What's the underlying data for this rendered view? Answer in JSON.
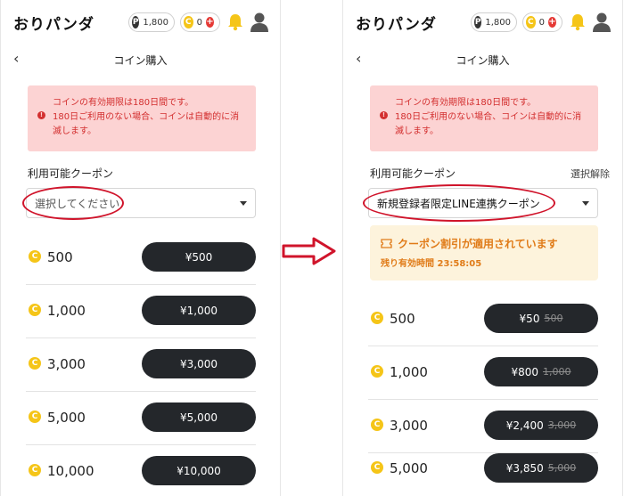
{
  "left": {
    "header": {
      "logo": "おりパンダ",
      "points": "1,800",
      "coins": "0"
    },
    "title": "コイン購入",
    "back": "‹",
    "alert": {
      "line1": "コインの有効期限は180日間です。",
      "line2": "180日ご利用のない場合、コインは自動的に消",
      "line3": "滅します。"
    },
    "coupon_label": "利用可能クーポン",
    "select_placeholder": "選択してください",
    "rows": [
      {
        "coins": "500",
        "price": "¥500"
      },
      {
        "coins": "1,000",
        "price": "¥1,000"
      },
      {
        "coins": "3,000",
        "price": "¥3,000"
      },
      {
        "coins": "5,000",
        "price": "¥5,000"
      },
      {
        "coins": "10,000",
        "price": "¥10,000"
      }
    ]
  },
  "right": {
    "header": {
      "logo": "おりパンダ",
      "points": "1,800",
      "coins": "0"
    },
    "title": "コイン購入",
    "back": "‹",
    "alert": {
      "line1": "コインの有効期限は180日間です。",
      "line2": "180日ご利用のない場合、コインは自動的に消",
      "line3": "滅します。"
    },
    "coupon_label": "利用可能クーポン",
    "deselect": "選択解除",
    "select_value": "新規登録者限定LINE連携クーポン",
    "banner": {
      "title": "クーポン割引が適用されています",
      "remaining": "残り有効時間 23:58:05"
    },
    "rows": [
      {
        "coins": "500",
        "price": "¥50",
        "orig": "500"
      },
      {
        "coins": "1,000",
        "price": "¥800",
        "orig": "1,000"
      },
      {
        "coins": "3,000",
        "price": "¥2,400",
        "orig": "3,000"
      },
      {
        "coins": "5,000",
        "price": "¥3,850",
        "orig": "5,000"
      }
    ]
  },
  "colors": {
    "alert_bg": "#fcd3d3",
    "alert_text": "#d32f2f",
    "button": "#24272b",
    "coin": "#f5c518",
    "banner_bg": "#fdf3dc",
    "banner_text": "#e07b18",
    "highlight_oval": "#d0142b"
  },
  "icons": {
    "point": "P",
    "coin": "C"
  }
}
